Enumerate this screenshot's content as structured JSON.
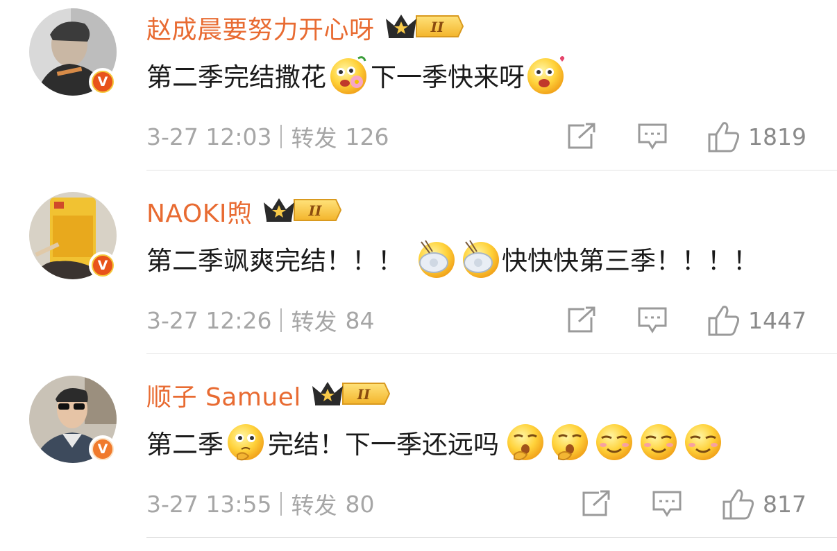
{
  "comments": [
    {
      "username": "赵成晨要努力开心呀",
      "text_parts": [
        "第二季完结撒花",
        "下一季快来呀"
      ],
      "time": "3-27 12:03",
      "repost_label": "转发",
      "repost_count": "126",
      "like_count": "1819",
      "verified_label": "V"
    },
    {
      "username": "NAOKI煦",
      "text_parts": [
        "第二季飒爽完结！！！",
        "快快快第三季！！！！"
      ],
      "time": "3-27 12:26",
      "repost_label": "转发",
      "repost_count": "84",
      "like_count": "1447",
      "verified_label": "V"
    },
    {
      "username": "顺子 Samuel",
      "text_parts": [
        "第二季",
        "完结！下一季还远吗"
      ],
      "time": "3-27 13:55",
      "repost_label": "转发",
      "repost_count": "80",
      "like_count": "817",
      "verified_label": "V"
    }
  ],
  "vip_level": "II",
  "colors": {
    "username": "#e86b32",
    "meta": "#a6a6a6",
    "vip_gold": "#f5c542"
  }
}
